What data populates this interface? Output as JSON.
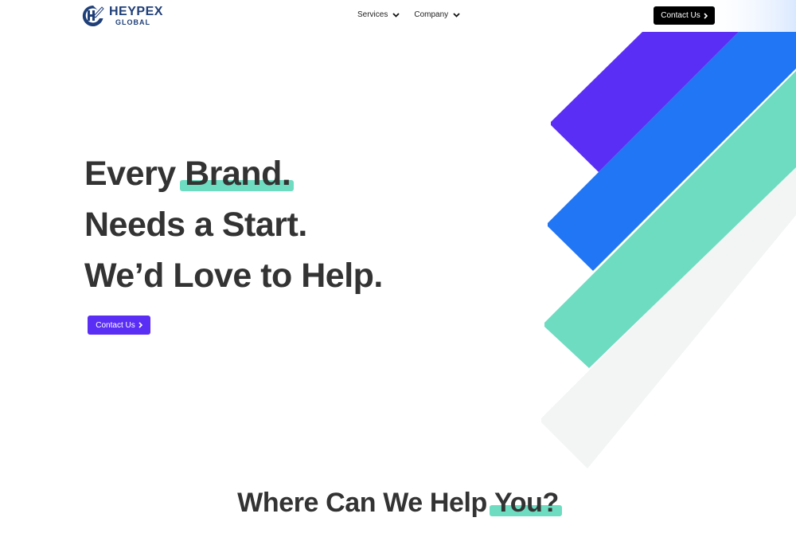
{
  "brand": {
    "name": "HEYPEX",
    "subtitle": "GLOBAL",
    "color": "#1f3f78"
  },
  "nav": {
    "items": [
      {
        "label": "Services",
        "icon": "chevron-down-icon"
      },
      {
        "label": "Company",
        "icon": "chevron-down-icon"
      }
    ]
  },
  "header": {
    "cta_label": "Contact Us",
    "cta_icon": "chevron-right-icon"
  },
  "hero": {
    "line1_prefix": "Every ",
    "line1_highlight": "Brand.",
    "line2": "Needs a Start.",
    "line3": "We’d Love to Help.",
    "cta_label": "Contact Us",
    "cta_icon": "chevron-right-icon",
    "highlight_color": "#6ddcc1",
    "cta_color": "#5b2ef5"
  },
  "section": {
    "title_prefix": "Where Can We Help ",
    "title_highlight": "You?"
  },
  "decor": {
    "stripe_colors": [
      "#5b2ef5",
      "#2176f5",
      "#6ddcc1",
      "#f2f5f3"
    ]
  }
}
